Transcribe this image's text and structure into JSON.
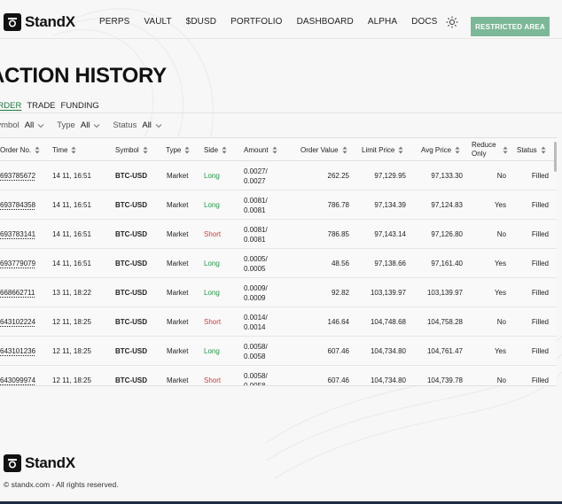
{
  "header": {
    "brand": "StandX",
    "nav": [
      "PERPS",
      "VAULT",
      "$DUSD",
      "PORTFOLIO",
      "DASHBOARD",
      "ALPHA",
      "DOCS"
    ],
    "restricted_label": "RESTRICTED AREA",
    "accent": "#7cb897"
  },
  "page": {
    "title": "ACTION HISTORY",
    "tabs": [
      "ORDER",
      "TRADE",
      "FUNDING"
    ],
    "active_tab": "ORDER"
  },
  "filters": [
    {
      "label": "Symbol",
      "value": "All"
    },
    {
      "label": "Type",
      "value": "All"
    },
    {
      "label": "Status",
      "value": "All"
    }
  ],
  "table": {
    "columns": {
      "order_no": "Order No.",
      "time": "Time",
      "symbol": "Symbol",
      "type": "Type",
      "side": "Side",
      "amount": "Amount",
      "order_value": "Order Value",
      "limit_price": "Limit Price",
      "avg_price": "Avg Price",
      "reduce_only_1": "Reduce",
      "reduce_only_2": "Only",
      "status": "Status"
    },
    "rows": [
      {
        "order_no": "693785672",
        "time": "14 11, 16:51",
        "symbol": "BTC-USD",
        "type": "Market",
        "side": "Long",
        "amount_1": "0.0027/",
        "amount_2": "0.0027",
        "order_value": "262.25",
        "limit_price": "97,129.95",
        "avg_price": "97,133.30",
        "reduce_only": "No",
        "status": "Filled"
      },
      {
        "order_no": "693784358",
        "time": "14 11, 16:51",
        "symbol": "BTC-USD",
        "type": "Market",
        "side": "Long",
        "amount_1": "0.0081/",
        "amount_2": "0.0081",
        "order_value": "786.78",
        "limit_price": "97,134.39",
        "avg_price": "97,124.83",
        "reduce_only": "Yes",
        "status": "Filled"
      },
      {
        "order_no": "693783141",
        "time": "14 11, 16:51",
        "symbol": "BTC-USD",
        "type": "Market",
        "side": "Short",
        "amount_1": "0.0081/",
        "amount_2": "0.0081",
        "order_value": "786.85",
        "limit_price": "97,143.14",
        "avg_price": "97,126.80",
        "reduce_only": "No",
        "status": "Filled"
      },
      {
        "order_no": "693779079",
        "time": "14 11, 16:51",
        "symbol": "BTC-USD",
        "type": "Market",
        "side": "Long",
        "amount_1": "0.0005/",
        "amount_2": "0.0005",
        "order_value": "48.56",
        "limit_price": "97,138.66",
        "avg_price": "97,161.40",
        "reduce_only": "Yes",
        "status": "Filled"
      },
      {
        "order_no": "668662711",
        "time": "13 11, 18:22",
        "symbol": "BTC-USD",
        "type": "Market",
        "side": "Long",
        "amount_1": "0.0009/",
        "amount_2": "0.0009",
        "order_value": "92.82",
        "limit_price": "103,139.97",
        "avg_price": "103,139.97",
        "reduce_only": "Yes",
        "status": "Filled"
      },
      {
        "order_no": "643102224",
        "time": "12 11, 18:25",
        "symbol": "BTC-USD",
        "type": "Market",
        "side": "Short",
        "amount_1": "0.0014/",
        "amount_2": "0.0014",
        "order_value": "146.64",
        "limit_price": "104,748.68",
        "avg_price": "104,758.28",
        "reduce_only": "No",
        "status": "Filled"
      },
      {
        "order_no": "643101236",
        "time": "12 11, 18:25",
        "symbol": "BTC-USD",
        "type": "Market",
        "side": "Long",
        "amount_1": "0.0058/",
        "amount_2": "0.0058",
        "order_value": "607.46",
        "limit_price": "104,734.80",
        "avg_price": "104,761.47",
        "reduce_only": "Yes",
        "status": "Filled"
      },
      {
        "order_no": "643099974",
        "time": "12 11, 18:25",
        "symbol": "BTC-USD",
        "type": "Market",
        "side": "Short",
        "amount_1": "0.0058/",
        "amount_2": "0.0058",
        "order_value": "607.46",
        "limit_price": "104,734.80",
        "avg_price": "104,739.78",
        "reduce_only": "No",
        "status": "Filled"
      }
    ]
  },
  "footer": {
    "brand": "StandX",
    "copyright": "© standx.com - All rights reserved."
  }
}
